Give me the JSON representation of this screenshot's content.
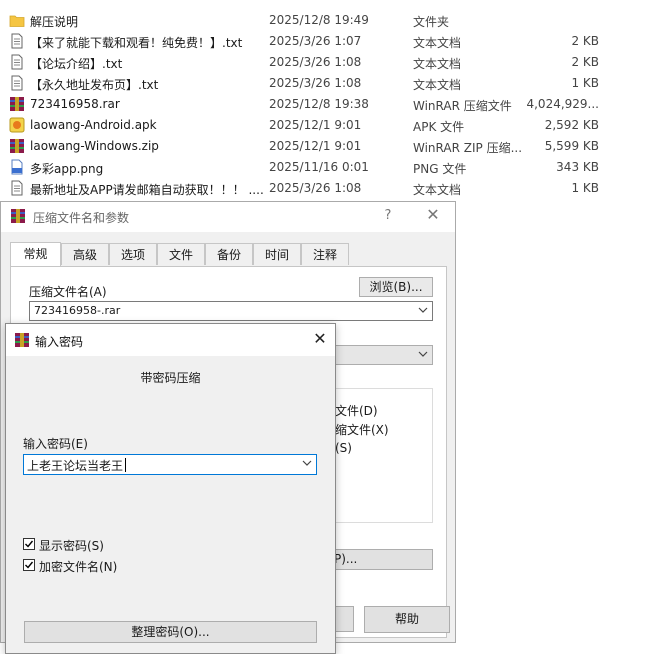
{
  "files": [
    {
      "name": "解压说明",
      "date": "2025/12/8 19:49",
      "type": "文件夹",
      "size": "",
      "icon": "folder-icon"
    },
    {
      "name": "【来了就能下载和观看！纯免费！】.txt",
      "date": "2025/3/26 1:07",
      "type": "文本文档",
      "size": "2 KB",
      "icon": "text-file-icon"
    },
    {
      "name": "【论坛介绍】.txt",
      "date": "2025/3/26 1:08",
      "type": "文本文档",
      "size": "2 KB",
      "icon": "text-file-icon"
    },
    {
      "name": "【永久地址发布页】.txt",
      "date": "2025/3/26 1:08",
      "type": "文本文档",
      "size": "1 KB",
      "icon": "text-file-icon"
    },
    {
      "name": "723416958.rar",
      "date": "2025/12/8 19:38",
      "type": "WinRAR 压缩文件",
      "size": "4,024,929...",
      "icon": "winrar-icon"
    },
    {
      "name": "laowang-Android.apk",
      "date": "2025/12/1 9:01",
      "type": "APK 文件",
      "size": "2,592 KB",
      "icon": "apk-icon"
    },
    {
      "name": "laowang-Windows.zip",
      "date": "2025/12/1 9:01",
      "type": "WinRAR ZIP 压缩...",
      "size": "5,599 KB",
      "icon": "winrar-icon"
    },
    {
      "name": "多彩app.png",
      "date": "2025/11/16 0:01",
      "type": "PNG 文件",
      "size": "343 KB",
      "icon": "png-file-icon"
    },
    {
      "name": "最新地址及APP请发邮箱自动获取！！！ ....",
      "date": "2025/3/26 1:08",
      "type": "文本文档",
      "size": "1 KB",
      "icon": "text-file-icon"
    }
  ],
  "archive_dialog": {
    "title": "压缩文件名和参数",
    "help_symbol": "?",
    "close_symbol": "✕",
    "tabs": [
      "常规",
      "高级",
      "选项",
      "文件",
      "备份",
      "时间",
      "注释"
    ],
    "archive_name_label": "压缩文件名(A)",
    "browse_button": "浏览(B)...",
    "archive_name_value": "723416958-.rar",
    "partial_options": [
      "文件(D)",
      "缩文件(X)",
      "(S)"
    ],
    "params_button_partial": "P)...",
    "help_button": "帮助"
  },
  "password_dialog": {
    "title": "输入密码",
    "close_symbol": "✕",
    "heading": "带密码压缩",
    "password_label": "输入密码(E)",
    "password_value": "上老王论坛当老王",
    "show_password_label": "显示密码(S)",
    "show_password_checked": true,
    "encrypt_names_label": "加密文件名(N)",
    "encrypt_names_checked": true,
    "organize_button": "整理密码(O)..."
  },
  "colors": {
    "accent": "#0078d7",
    "folder": "#f5c542",
    "winrar_red": "#b22222"
  }
}
